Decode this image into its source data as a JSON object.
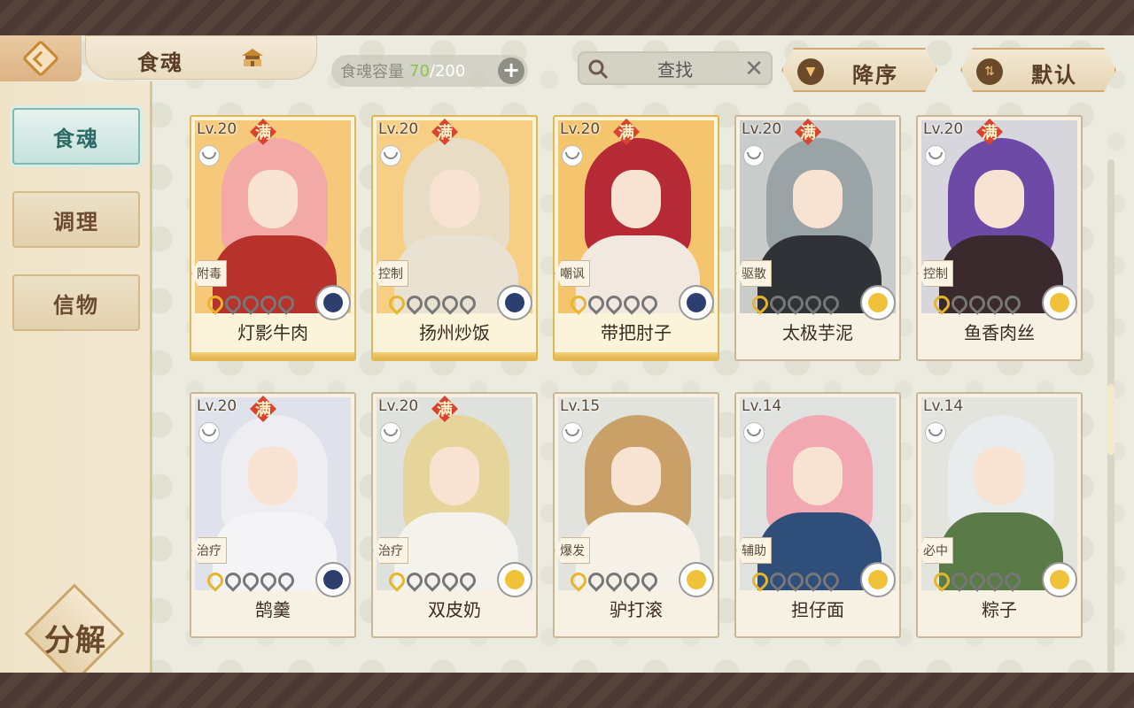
{
  "header": {
    "title": "食魂",
    "capacity_label": "食魂容量",
    "capacity_current": "70",
    "capacity_separator": "/",
    "capacity_max": "200",
    "add_symbol": "+",
    "search_placeholder": "查找",
    "clear_symbol": "✕",
    "sort_label": "降序",
    "default_label": "默认"
  },
  "sidebar": {
    "items": [
      {
        "label": "食魂",
        "active": true
      },
      {
        "label": "调理",
        "active": false
      },
      {
        "label": "信物",
        "active": false
      }
    ],
    "decompose_label": "分解"
  },
  "colors": {
    "accent": "#e1b655",
    "active_tab": "#7fb9b0",
    "capacity_current": "#8bc34a",
    "full_badge": "#d9432f"
  },
  "cards": [
    {
      "level": "Lv.20",
      "full": "满",
      "role": "附毒",
      "name": "灯影牛肉",
      "stars": 1,
      "flower": "navy",
      "bg": "#f5c87a",
      "hair": "#f3a9a6",
      "body": "#b8322c",
      "gold": true
    },
    {
      "level": "Lv.20",
      "full": "满",
      "role": "控制",
      "name": "扬州炒饭",
      "stars": 1,
      "flower": "navy",
      "bg": "#f6cf85",
      "hair": "#e8dcc4",
      "body": "#e9e2d2",
      "gold": true
    },
    {
      "level": "Lv.20",
      "full": "满",
      "role": "嘲讽",
      "name": "带把肘子",
      "stars": 1,
      "flower": "navy",
      "bg": "#f4c56c",
      "hair": "#b62a35",
      "body": "#f1e8e0",
      "gold": true
    },
    {
      "level": "Lv.20",
      "full": "满",
      "role": "驱散",
      "name": "太极芋泥",
      "stars": 1,
      "flower": "gold",
      "bg": "#c9ccca",
      "hair": "#9aa3a6",
      "body": "#2f3236",
      "gold": false
    },
    {
      "level": "Lv.20",
      "full": "满",
      "role": "控制",
      "name": "鱼香肉丝",
      "stars": 1,
      "flower": "gold",
      "bg": "#d6d6dc",
      "hair": "#6d4aa6",
      "body": "#3a2a2e",
      "gold": false
    },
    {
      "level": "Lv.20",
      "full": "满",
      "role": "治疗",
      "name": "鹄羹",
      "stars": 1,
      "flower": "navy",
      "bg": "#dfe2ea",
      "hair": "#eeeef2",
      "body": "#f4f4f6",
      "gold": false
    },
    {
      "level": "Lv.20",
      "full": "满",
      "role": "治疗",
      "name": "双皮奶",
      "stars": 1,
      "flower": "gold",
      "bg": "#dfe1dc",
      "hair": "#e6d59a",
      "body": "#f4f2ec",
      "gold": false
    },
    {
      "level": "Lv.15",
      "full": "",
      "role": "爆发",
      "name": "驴打滚",
      "stars": 1,
      "flower": "gold",
      "bg": "#e3e3de",
      "hair": "#c9a067",
      "body": "#f5f0e8",
      "gold": false
    },
    {
      "level": "Lv.14",
      "full": "",
      "role": "辅助",
      "name": "担仔面",
      "stars": 1,
      "flower": "gold",
      "bg": "#e0e2e0",
      "hair": "#f1a8b0",
      "body": "#2f4f7a",
      "gold": false
    },
    {
      "level": "Lv.14",
      "full": "",
      "role": "必中",
      "name": "粽子",
      "stars": 1,
      "flower": "gold",
      "bg": "#e3e4de",
      "hair": "#e8ecec",
      "body": "#5a7a48",
      "gold": false
    }
  ]
}
